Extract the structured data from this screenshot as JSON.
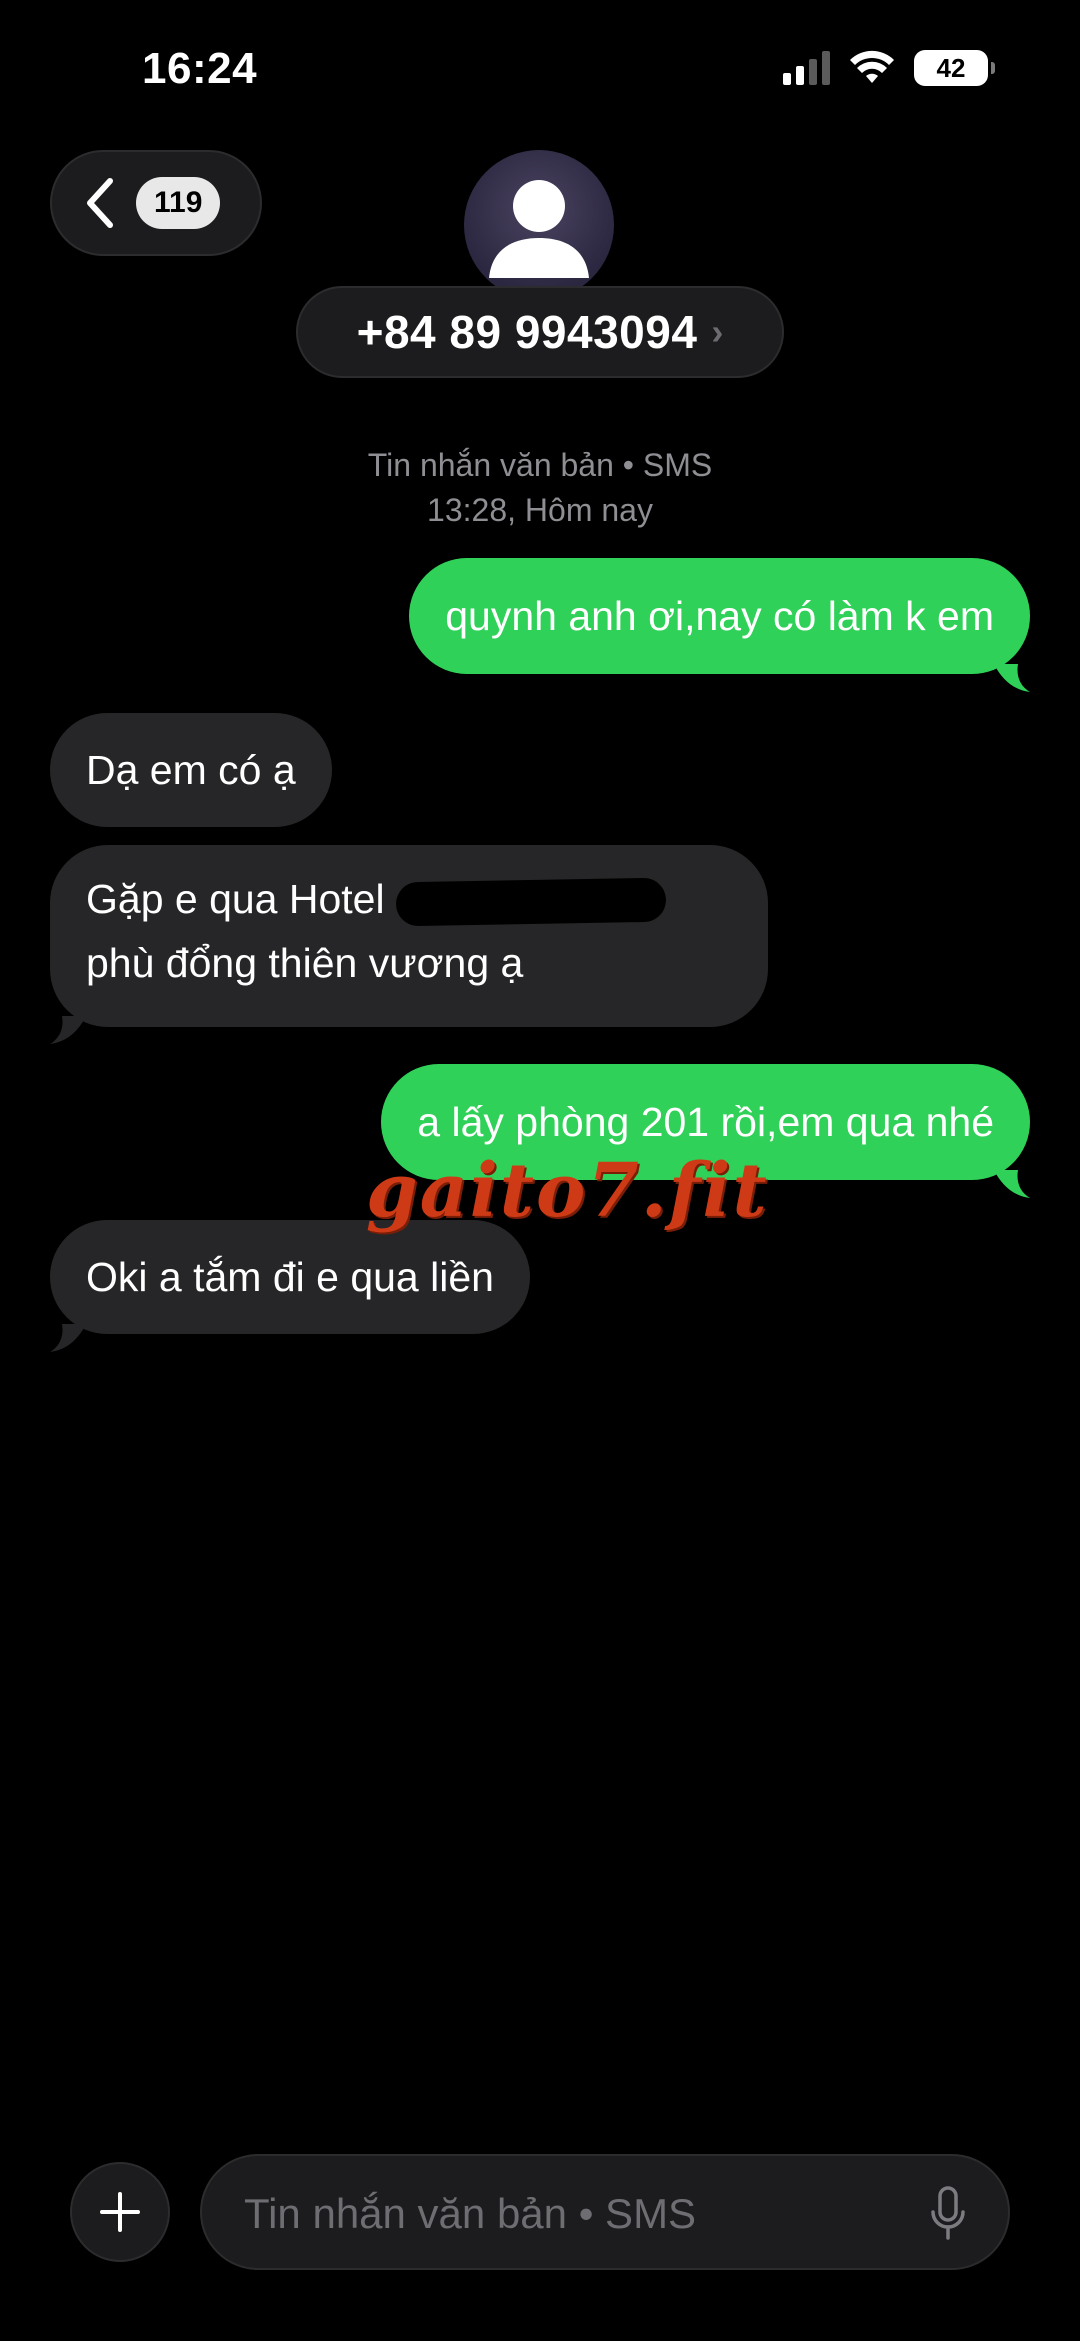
{
  "status_bar": {
    "time": "16:24",
    "battery": "42"
  },
  "header": {
    "unread_count": "119",
    "contact": "+84 89 9943094",
    "contact_chevron": "›"
  },
  "thread_meta": {
    "service": "Tin nhắn văn bản • SMS",
    "timestamp": "13:28, Hôm nay"
  },
  "messages": [
    {
      "direction": "outgoing",
      "text": "quynh anh ơi,nay có làm k em"
    },
    {
      "direction": "incoming",
      "text": "Dạ em có ạ"
    },
    {
      "direction": "incoming",
      "line1": "Gặp e qua Hotel",
      "line2": "phù đổng thiên vương ạ"
    },
    {
      "direction": "outgoing",
      "text": "a lấy phòng 201 rồi,em qua nhé"
    },
    {
      "direction": "incoming",
      "text": "Oki a tắm đi e qua liền"
    }
  ],
  "watermark": "gaito7.fit",
  "composer": {
    "placeholder": "Tin nhắn văn bản • SMS"
  },
  "colors": {
    "outgoing": "#30d158",
    "incoming": "#262628",
    "background": "#000000",
    "watermark": "#cf3a16"
  },
  "icons": [
    "back-chevron-icon",
    "person-icon",
    "signal-icon",
    "wifi-icon",
    "battery-icon",
    "plus-icon",
    "mic-icon"
  ]
}
